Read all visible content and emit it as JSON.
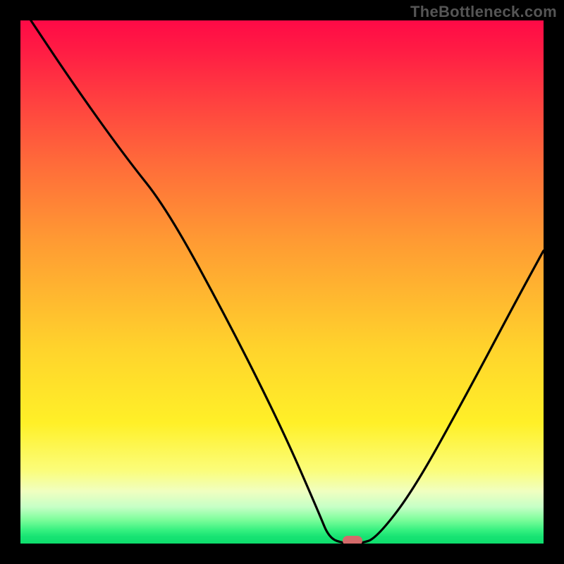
{
  "watermark": "TheBottleneck.com",
  "chart_data": {
    "type": "line",
    "title": "",
    "xlabel": "",
    "ylabel": "",
    "xlim": [
      0,
      100
    ],
    "ylim": [
      0,
      100
    ],
    "grid": false,
    "legend": false,
    "series": [
      {
        "name": "bottleneck-curve",
        "x": [
          2,
          10,
          20,
          28,
          40,
          50,
          57,
          59,
          62,
          65,
          68,
          75,
          85,
          94,
          100
        ],
        "y": [
          100,
          88,
          74,
          64,
          42,
          22,
          6,
          1,
          0,
          0,
          1,
          10,
          28,
          45,
          56
        ]
      }
    ],
    "marker": {
      "x": 63.5,
      "y": 0.5,
      "label": "optimal-point"
    },
    "gradient_stops": [
      {
        "pct": 0,
        "color": "#ff0a46"
      },
      {
        "pct": 27,
        "color": "#ff6a3a"
      },
      {
        "pct": 63,
        "color": "#ffd42c"
      },
      {
        "pct": 90,
        "color": "#f0ffc0"
      },
      {
        "pct": 97.5,
        "color": "#34f07f"
      },
      {
        "pct": 100,
        "color": "#0ede6d"
      }
    ]
  },
  "colors": {
    "frame": "#000000",
    "watermark": "#555555",
    "curve": "#000000",
    "marker": "#d46a6a"
  }
}
